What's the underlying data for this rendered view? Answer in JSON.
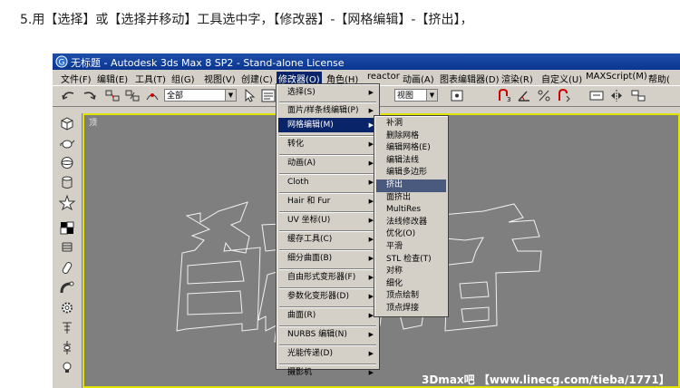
{
  "caption": "5.用【选择】或【选择并移动】工具选中字，【修改器】-【网格编辑】-【挤出】，",
  "window": {
    "title": "无标题 - Autodesk 3ds Max 8 SP2 - Stand-alone License"
  },
  "menubar": [
    "文件(F)",
    "编辑(E)",
    "工具(T)",
    "组(G)",
    "视图(V)",
    "创建(C)",
    "修改器(O)",
    "角色(H)",
    "reactor",
    "动画(A)",
    "图表编辑器(D)",
    "渲染(R)",
    "自定义(U)",
    "MAXScript(M)",
    "帮助("
  ],
  "toolbar": {
    "selection_filter": "全部",
    "view_combo": "视图"
  },
  "viewport": {
    "label": "顶",
    "watermark": "3Dmax吧 【www.linecg.com/tieba/1771】"
  },
  "modifiers_menu": [
    {
      "label": "选择(S)",
      "arrow": true
    },
    {
      "label": "面片/样条线编辑(P)",
      "arrow": true
    },
    {
      "label": "网格编辑(M)",
      "arrow": true
    },
    {
      "label": "转化",
      "arrow": true
    },
    {
      "label": "动画(A)",
      "arrow": true
    },
    {
      "label": "Cloth",
      "arrow": true
    },
    {
      "label": "Hair 和 Fur",
      "arrow": true
    },
    {
      "label": "UV 坐标(U)",
      "arrow": true
    },
    {
      "label": "缓存工具(C)",
      "arrow": true
    },
    {
      "label": "细分曲面(B)",
      "arrow": true
    },
    {
      "label": "自由形式变形器(F)",
      "arrow": true
    },
    {
      "label": "参数化变形器(D)",
      "arrow": true
    },
    {
      "label": "曲面(R)",
      "arrow": true
    },
    {
      "label": "NURBS 编辑(N)",
      "arrow": true
    },
    {
      "label": "光能传递(D)",
      "arrow": true
    },
    {
      "label": "摄影机",
      "arrow": true
    }
  ],
  "mesh_edit_submenu": [
    "补洞",
    "删除网格",
    "编辑网格(E)",
    "编辑法线",
    "编辑多边形",
    "挤出",
    "面挤出",
    "MultiRes",
    "法线修改器",
    "优化(O)",
    "平滑",
    "STL 检查(T)",
    "对称",
    "细化",
    "顶点绘制",
    "顶点焊接"
  ],
  "colors": {
    "menu_highlight": "#0a246a",
    "submenu_highlight": "#4a5a7e",
    "viewport_bg": "#7f7f7f",
    "viewport_border": "#e3e300"
  }
}
